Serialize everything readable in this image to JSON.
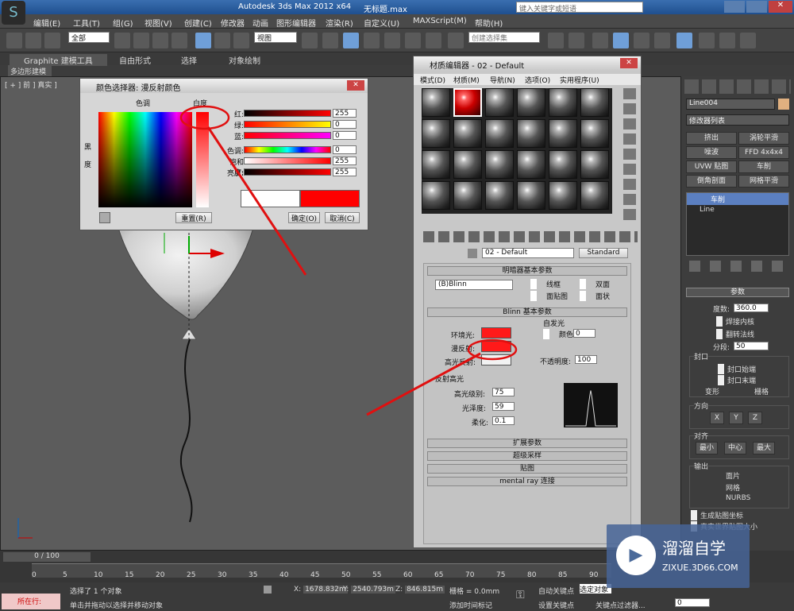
{
  "app": {
    "title": "Autodesk 3ds Max  2012 x64",
    "file": "无标题.max",
    "search_placeholder": "键入关键字或短语"
  },
  "menu": [
    "编辑(E)",
    "工具(T)",
    "组(G)",
    "视图(V)",
    "创建(C)",
    "修改器",
    "动画",
    "图形编辑器",
    "渲染(R)",
    "自定义(U)",
    "MAXScript(M)",
    "帮助(H)"
  ],
  "toolbar": {
    "selection_filter": "全部",
    "ref_coord": "视图",
    "named_selection": "创建选择集"
  },
  "ribbon": {
    "tabs": [
      "Graphite 建模工具",
      "自由形式",
      "选择",
      "对象绘制"
    ],
    "sub": "多边形建模"
  },
  "viewport": {
    "label": "[ + ] 前 ] 真实 ]"
  },
  "color_picker": {
    "title": "颜色选择器: 漫反射颜色",
    "hue_label": "色调",
    "white_label": "白度",
    "black_label": "黑度",
    "channels": [
      {
        "label": "红:",
        "value": "255"
      },
      {
        "label": "绿:",
        "value": "0"
      },
      {
        "label": "蓝:",
        "value": "0"
      },
      {
        "label": "色调:",
        "value": "0"
      },
      {
        "label": "饱和度:",
        "value": "255"
      },
      {
        "label": "亮度:",
        "value": "255"
      }
    ],
    "reset": "重置(R)",
    "ok": "确定(O)",
    "cancel": "取消(C)",
    "new_color": "#ff0000",
    "old_color": "#ffffff"
  },
  "material_editor": {
    "title": "材质编辑器 - 02 - Default",
    "menu": [
      "模式(D)",
      "材质(M)",
      "导航(N)",
      "选项(O)",
      "实用程序(U)"
    ],
    "mat_name": "02 - Default",
    "mat_type": "Standard",
    "shader_rollout": "明暗器基本参数",
    "shader": "(B)Blinn",
    "shader_opts": [
      "线框",
      "双面",
      "面贴图",
      "面状"
    ],
    "blinn_rollout": "Blinn 基本参数",
    "self_illum": "自发光",
    "color_label": "颜色",
    "self_illum_value": "0",
    "ambient": "环境光:",
    "diffuse": "漫反射:",
    "specular": "高光反射:",
    "opacity_label": "不透明度:",
    "opacity": "100",
    "spec_section": "反射高光",
    "spec_level_label": "高光级别:",
    "spec_level": "75",
    "gloss_label": "光泽度:",
    "gloss": "59",
    "soften_label": "柔化:",
    "soften": "0.1",
    "collapsed": [
      "扩展参数",
      "超级采样",
      "贴图",
      "mental ray 连接"
    ]
  },
  "command_panel": {
    "object_name": "Line004",
    "modifier_list": "修改器列表",
    "buttons": [
      "挤出",
      "涡轮平滑",
      "噪波",
      "FFD 4x4x4",
      "UVW 贴图",
      "车削",
      "倒角剖面",
      "网格平滑"
    ],
    "stack": [
      "车削",
      "Line"
    ],
    "params_title": "参数",
    "degrees_label": "度数:",
    "degrees": "360.0",
    "weld_core": "焊接内核",
    "flip_normals": "翻转法线",
    "segments_label": "分段:",
    "segments": "50",
    "capping": "封口",
    "cap_start": "封口始端",
    "cap_end": "封口末端",
    "morph": "变形",
    "grid": "栅格",
    "direction": "方向",
    "axes": [
      "X",
      "Y",
      "Z"
    ],
    "align": "对齐",
    "align_btns": [
      "最小",
      "中心",
      "最大"
    ],
    "output": "输出",
    "outputs": [
      "面片",
      "网格",
      "NURBS"
    ],
    "gen_map": "生成贴图坐标",
    "real_world": "真实世界贴图大小"
  },
  "timeline": {
    "frame": "0 / 100",
    "ticks": [
      "0",
      "5",
      "10",
      "15",
      "20",
      "25",
      "30",
      "35",
      "40",
      "45",
      "50",
      "55",
      "60",
      "65",
      "70",
      "75",
      "80",
      "85",
      "90"
    ]
  },
  "status": {
    "mode": "所在行:",
    "msg1": "选择了 1 个对象",
    "msg2": "单击并拖动以选择并移动对象",
    "x": "1678.832m",
    "y": "2540.793m",
    "z": "846.815m",
    "grid": "栅格 = 0.0mm",
    "auto_key": "自动关键点",
    "selected": "选定对象",
    "set_key": "设置关键点",
    "key_filters": "关键点过滤器...",
    "add_time_tag": "添加时间标记",
    "frame": "0"
  },
  "watermark": {
    "brand": "溜溜自学",
    "url": "ZIXUE.3D66.COM"
  }
}
